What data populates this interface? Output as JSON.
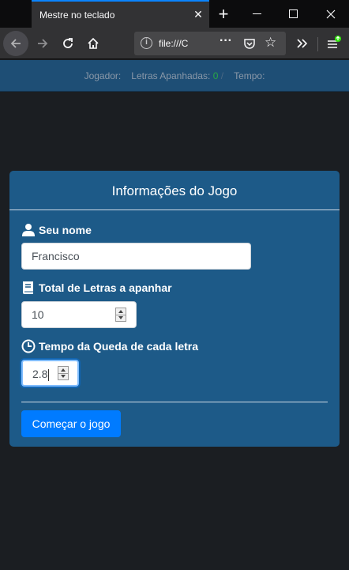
{
  "browser": {
    "tab_title": "Mestre no teclado",
    "url": "file:///C",
    "close_glyph": "✕",
    "newtab_glyph": "+",
    "minimize_glyph": "—",
    "maximize_glyph": "☐",
    "window_close_glyph": "✕"
  },
  "status": {
    "player_label": "Jogador:",
    "letters_label": "Letras Apanhadas:",
    "score": "0",
    "separator": "/",
    "time_label": "Tempo:"
  },
  "card": {
    "title": "Informações do Jogo",
    "name_label": "Seu nome",
    "name_value": "Francisco",
    "letters_label": "Total de Letras a apanhar",
    "letters_value": "10",
    "time_label": "Tempo da Queda de cada letra",
    "time_value": "2.8",
    "start_button": "Começar o jogo"
  },
  "colors": {
    "card_bg": "#1d5a88",
    "statusbar_bg": "#1e4e75",
    "page_bg": "#1b1e22",
    "primary_button": "#007bff",
    "score_color": "#28a745"
  }
}
